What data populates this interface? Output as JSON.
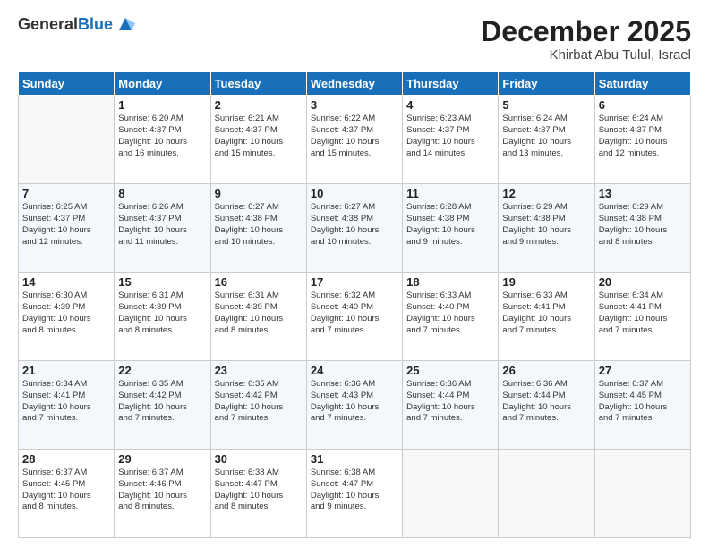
{
  "header": {
    "logo_general": "General",
    "logo_blue": "Blue",
    "month_title": "December 2025",
    "location": "Khirbat Abu Tulul, Israel"
  },
  "weekdays": [
    "Sunday",
    "Monday",
    "Tuesday",
    "Wednesday",
    "Thursday",
    "Friday",
    "Saturday"
  ],
  "weeks": [
    [
      {
        "day": "",
        "empty": true
      },
      {
        "day": "1",
        "sunrise": "6:20 AM",
        "sunset": "4:37 PM",
        "daylight": "10 hours and 16 minutes."
      },
      {
        "day": "2",
        "sunrise": "6:21 AM",
        "sunset": "4:37 PM",
        "daylight": "10 hours and 15 minutes."
      },
      {
        "day": "3",
        "sunrise": "6:22 AM",
        "sunset": "4:37 PM",
        "daylight": "10 hours and 15 minutes."
      },
      {
        "day": "4",
        "sunrise": "6:23 AM",
        "sunset": "4:37 PM",
        "daylight": "10 hours and 14 minutes."
      },
      {
        "day": "5",
        "sunrise": "6:24 AM",
        "sunset": "4:37 PM",
        "daylight": "10 hours and 13 minutes."
      },
      {
        "day": "6",
        "sunrise": "6:24 AM",
        "sunset": "4:37 PM",
        "daylight": "10 hours and 12 minutes."
      }
    ],
    [
      {
        "day": "7",
        "sunrise": "6:25 AM",
        "sunset": "4:37 PM",
        "daylight": "10 hours and 12 minutes."
      },
      {
        "day": "8",
        "sunrise": "6:26 AM",
        "sunset": "4:37 PM",
        "daylight": "10 hours and 11 minutes."
      },
      {
        "day": "9",
        "sunrise": "6:27 AM",
        "sunset": "4:38 PM",
        "daylight": "10 hours and 10 minutes."
      },
      {
        "day": "10",
        "sunrise": "6:27 AM",
        "sunset": "4:38 PM",
        "daylight": "10 hours and 10 minutes."
      },
      {
        "day": "11",
        "sunrise": "6:28 AM",
        "sunset": "4:38 PM",
        "daylight": "10 hours and 9 minutes."
      },
      {
        "day": "12",
        "sunrise": "6:29 AM",
        "sunset": "4:38 PM",
        "daylight": "10 hours and 9 minutes."
      },
      {
        "day": "13",
        "sunrise": "6:29 AM",
        "sunset": "4:38 PM",
        "daylight": "10 hours and 8 minutes."
      }
    ],
    [
      {
        "day": "14",
        "sunrise": "6:30 AM",
        "sunset": "4:39 PM",
        "daylight": "10 hours and 8 minutes."
      },
      {
        "day": "15",
        "sunrise": "6:31 AM",
        "sunset": "4:39 PM",
        "daylight": "10 hours and 8 minutes."
      },
      {
        "day": "16",
        "sunrise": "6:31 AM",
        "sunset": "4:39 PM",
        "daylight": "10 hours and 8 minutes."
      },
      {
        "day": "17",
        "sunrise": "6:32 AM",
        "sunset": "4:40 PM",
        "daylight": "10 hours and 7 minutes."
      },
      {
        "day": "18",
        "sunrise": "6:33 AM",
        "sunset": "4:40 PM",
        "daylight": "10 hours and 7 minutes."
      },
      {
        "day": "19",
        "sunrise": "6:33 AM",
        "sunset": "4:41 PM",
        "daylight": "10 hours and 7 minutes."
      },
      {
        "day": "20",
        "sunrise": "6:34 AM",
        "sunset": "4:41 PM",
        "daylight": "10 hours and 7 minutes."
      }
    ],
    [
      {
        "day": "21",
        "sunrise": "6:34 AM",
        "sunset": "4:41 PM",
        "daylight": "10 hours and 7 minutes."
      },
      {
        "day": "22",
        "sunrise": "6:35 AM",
        "sunset": "4:42 PM",
        "daylight": "10 hours and 7 minutes."
      },
      {
        "day": "23",
        "sunrise": "6:35 AM",
        "sunset": "4:42 PM",
        "daylight": "10 hours and 7 minutes."
      },
      {
        "day": "24",
        "sunrise": "6:36 AM",
        "sunset": "4:43 PM",
        "daylight": "10 hours and 7 minutes."
      },
      {
        "day": "25",
        "sunrise": "6:36 AM",
        "sunset": "4:44 PM",
        "daylight": "10 hours and 7 minutes."
      },
      {
        "day": "26",
        "sunrise": "6:36 AM",
        "sunset": "4:44 PM",
        "daylight": "10 hours and 7 minutes."
      },
      {
        "day": "27",
        "sunrise": "6:37 AM",
        "sunset": "4:45 PM",
        "daylight": "10 hours and 7 minutes."
      }
    ],
    [
      {
        "day": "28",
        "sunrise": "6:37 AM",
        "sunset": "4:45 PM",
        "daylight": "10 hours and 8 minutes."
      },
      {
        "day": "29",
        "sunrise": "6:37 AM",
        "sunset": "4:46 PM",
        "daylight": "10 hours and 8 minutes."
      },
      {
        "day": "30",
        "sunrise": "6:38 AM",
        "sunset": "4:47 PM",
        "daylight": "10 hours and 8 minutes."
      },
      {
        "day": "31",
        "sunrise": "6:38 AM",
        "sunset": "4:47 PM",
        "daylight": "10 hours and 9 minutes."
      },
      {
        "day": "",
        "empty": true
      },
      {
        "day": "",
        "empty": true
      },
      {
        "day": "",
        "empty": true
      }
    ]
  ]
}
